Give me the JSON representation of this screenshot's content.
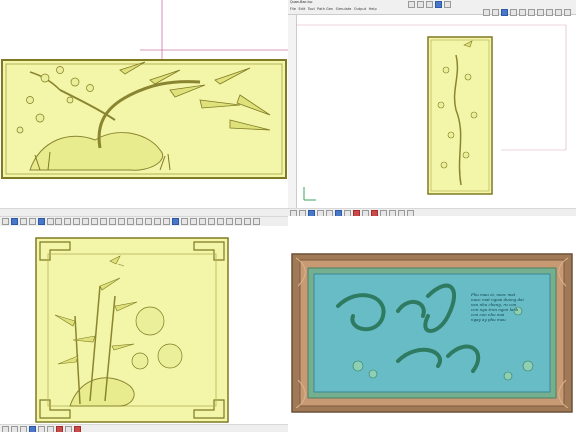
{
  "window": {
    "title": "Quan-Bac.lcp",
    "menu": [
      "File",
      "Edit",
      "Tool",
      "Path Gen",
      "Simulate",
      "Output",
      "Help"
    ]
  },
  "poem_lines": [
    "Phu mau oi, nuoc mat",
    "nuoc mat ngoai duong dai",
    "van nhu chang, ru con",
    "con ngu tron ngon lanh",
    "con con nho mai",
    "ngay ay phu mau"
  ],
  "colors": {
    "relief_fill": "#f3f5a8",
    "relief_stroke": "#7f7a23",
    "ornament_teal": "#5fb7c2",
    "ornament_bronze": "#a07a57"
  },
  "icons": {
    "axis": "axis-gizmo-icon",
    "toolbar": "toolbar-icons"
  }
}
